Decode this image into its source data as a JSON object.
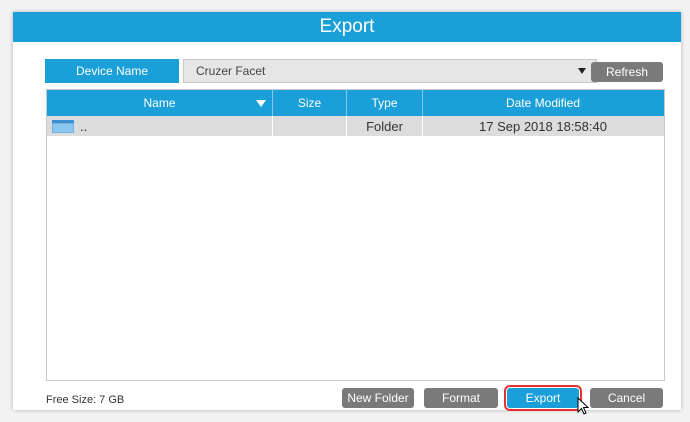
{
  "dialog": {
    "title": "Export"
  },
  "device": {
    "label": "Device Name",
    "selected": "Cruzer Facet",
    "refresh_label": "Refresh"
  },
  "table": {
    "headers": {
      "name": "Name",
      "size": "Size",
      "type": "Type",
      "date": "Date Modified"
    },
    "rows": [
      {
        "name": "..",
        "size": "",
        "type": "Folder",
        "date": "17 Sep 2018 18:58:40"
      }
    ]
  },
  "footer": {
    "free_size": "Free Size: 7 GB",
    "new_folder_label": "New Folder",
    "format_label": "Format",
    "export_label": "Export",
    "cancel_label": "Cancel"
  },
  "colors": {
    "accent": "#1a9fd9",
    "button": "#7a7a7a",
    "row": "#dcdcdc",
    "highlight": "#e5302d"
  }
}
